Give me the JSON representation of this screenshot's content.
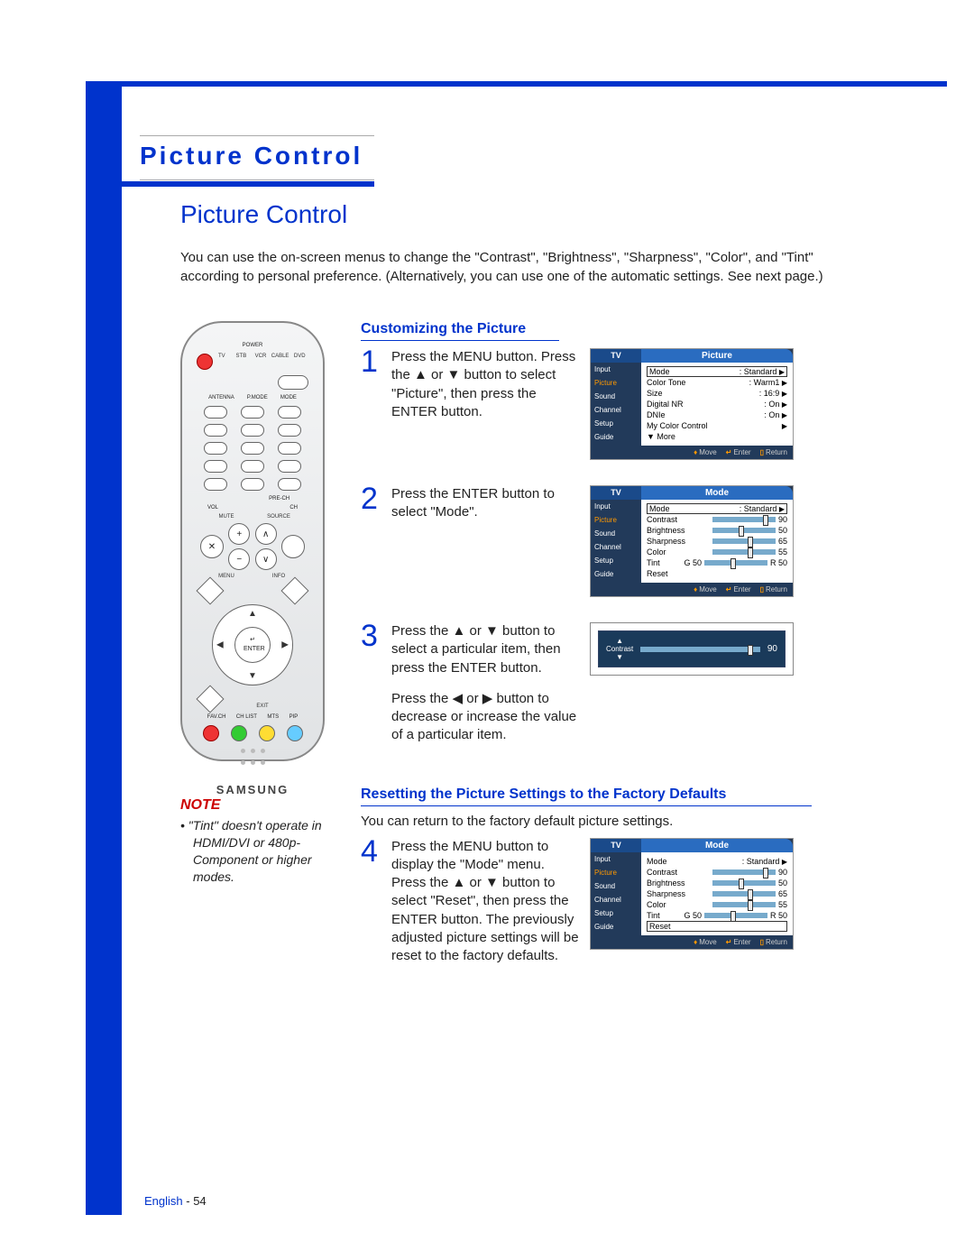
{
  "page": {
    "header": "Picture Control",
    "title": "Picture Control",
    "intro": "You can use the on-screen menus to change the \"Contrast\", \"Brightness\", \"Sharpness\", \"Color\", and \"Tint\" according to personal preference. (Alternatively, you can use one of the automatic settings. See next page.)",
    "footer_lang": "English",
    "footer_page": "- 54"
  },
  "note": {
    "heading": "NOTE",
    "body": "• \"Tint\" doesn't operate in HDMI/DVI or 480p-Component or higher modes."
  },
  "remote": {
    "power": "POWER",
    "top_modes": [
      "TV",
      "STB",
      "VCR",
      "CABLE",
      "DVD"
    ],
    "antenna": "ANTENNA",
    "pmode": "P.MODE",
    "mode": "MODE",
    "prech": "PRE-CH",
    "vol": "VOL",
    "ch": "CH",
    "mute": "MUTE",
    "source": "SOURCE",
    "menu": "MENU",
    "info": "INFO",
    "exit": "EXIT",
    "enter": "ENTER",
    "favch": "FAV.CH",
    "chlist": "CH LIST",
    "mts": "MTS",
    "pip": "PIP",
    "brand": "SAMSUNG"
  },
  "sections": {
    "customize": "Customizing the Picture",
    "reset": "Resetting the Picture Settings to the Factory Defaults",
    "reset_intro": "You can return to the factory default picture settings."
  },
  "steps": {
    "s1": "Press the MENU button. Press the ▲ or ▼ button to select \"Picture\", then press the ENTER button.",
    "s2": "Press the ENTER button to select \"Mode\".",
    "s3a": "Press the ▲ or ▼ button to select a particular item, then press the ENTER button.",
    "s3b": "Press the ◀ or ▶ button to decrease or increase the value of a particular item.",
    "s4": "Press the MENU button to display the \"Mode\" menu. Press the ▲ or ▼ button to select \"Reset\", then press the ENTER button. The previously adjusted picture settings will be reset to the factory defaults."
  },
  "osd": {
    "tv": "TV",
    "nav": [
      "Input",
      "Picture",
      "Sound",
      "Channel",
      "Setup",
      "Guide"
    ],
    "foot_move": "Move",
    "foot_enter": "Enter",
    "foot_return": "Return",
    "screen1": {
      "title": "Picture",
      "rows": [
        {
          "k": "Mode",
          "v": ": Standard"
        },
        {
          "k": "Color Tone",
          "v": ": Warm1"
        },
        {
          "k": "Size",
          "v": ": 16:9"
        },
        {
          "k": "Digital NR",
          "v": ": On"
        },
        {
          "k": "DNIe",
          "v": ": On"
        },
        {
          "k": "My Color Control",
          "v": ""
        },
        {
          "k": "▼ More",
          "v": ""
        }
      ]
    },
    "screen2": {
      "title": "Mode",
      "mode": {
        "k": "Mode",
        "v": ": Standard"
      },
      "sliders": [
        {
          "k": "Contrast",
          "v": "90"
        },
        {
          "k": "Brightness",
          "v": "50"
        },
        {
          "k": "Sharpness",
          "v": "65"
        },
        {
          "k": "Color",
          "v": "55"
        }
      ],
      "tint": {
        "k": "Tint",
        "l": "G 50",
        "r": "R 50"
      },
      "reset": "Reset"
    },
    "screen3": {
      "label": "Contrast",
      "value": "90"
    },
    "screen4_reset": "Reset"
  }
}
